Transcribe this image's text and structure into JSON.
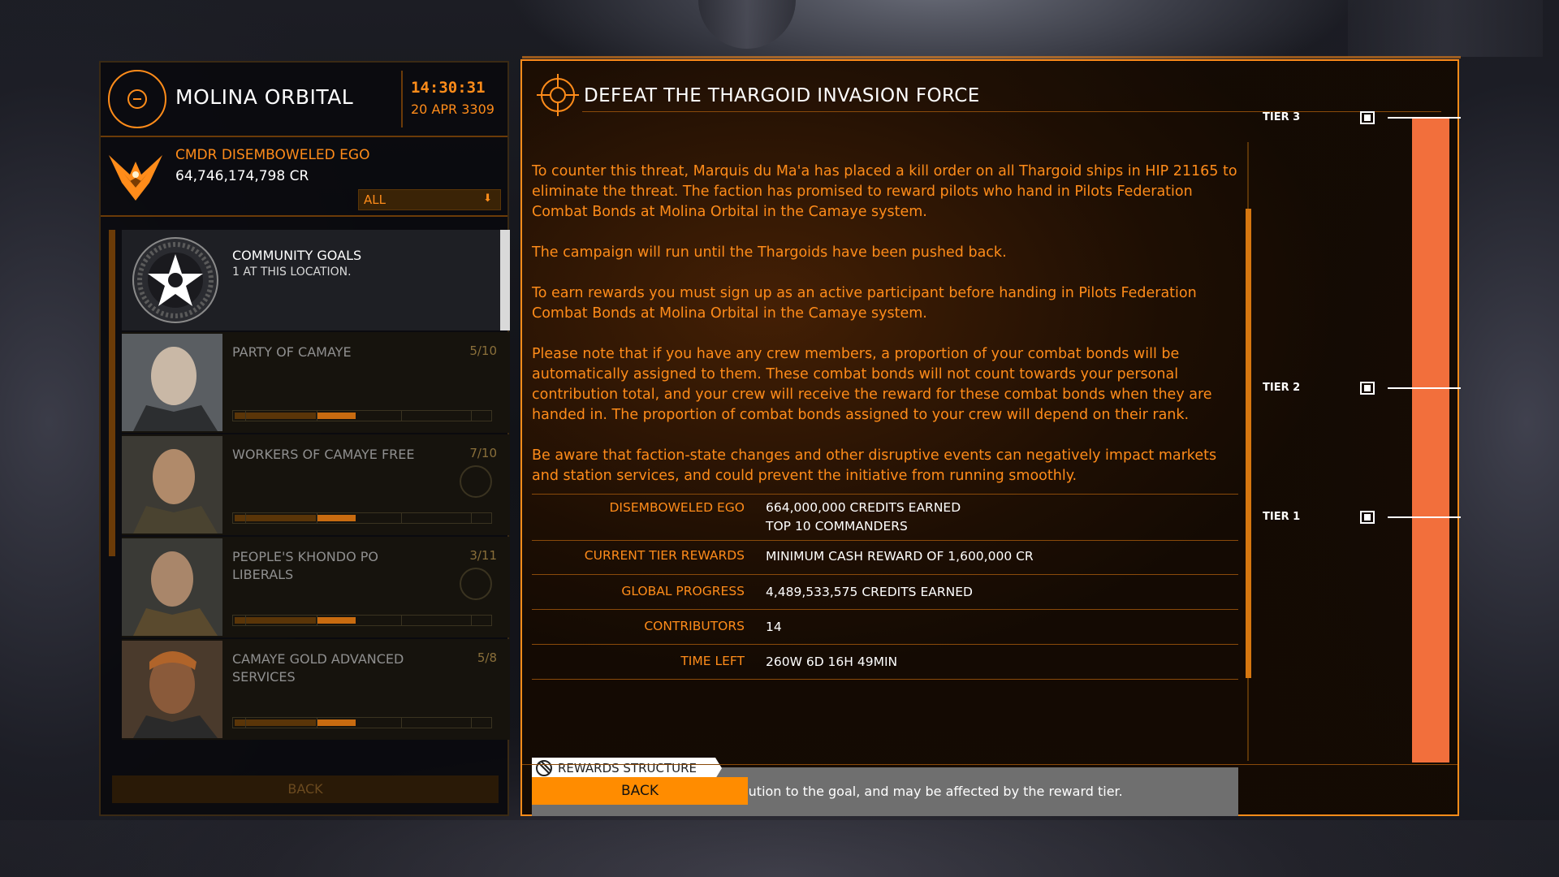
{
  "station": {
    "name": "MOLINA ORBITAL",
    "time": "14:30:31",
    "date": "20 APR 3309"
  },
  "commander": {
    "name": "CMDR DISEMBOWELED EGO",
    "credits": "64,746,174,798 CR",
    "filter": "ALL"
  },
  "community_goals_entry": {
    "title": "COMMUNITY GOALS",
    "subtitle": "1 AT THIS LOCATION."
  },
  "factions": [
    {
      "name": "PARTY OF CAMAYE",
      "count": "5/10",
      "reputation": 0.5
    },
    {
      "name": "WORKERS OF CAMAYE FREE",
      "count": "7/10",
      "reputation": 0.5
    },
    {
      "name": "PEOPLE'S KHONDO PO LIBERALS",
      "count": "3/11",
      "reputation": 0.5
    },
    {
      "name": "CAMAYE GOLD ADVANCED SERVICES",
      "count": "5/8",
      "reputation": 0.5
    }
  ],
  "left_back_label": "BACK",
  "goal": {
    "title": "DEFEAT THE THARGOID INVASION FORCE",
    "paragraphs": [
      "To counter this threat, Marquis du Ma'a has placed a kill order on all Thargoid ships in HIP 21165 to eliminate the threat. The faction has promised to reward pilots who hand in Pilots Federation Combat Bonds at Molina Orbital in the Camaye system.",
      "The campaign will run until the Thargoids have been pushed back.",
      "To earn rewards you must sign up as an active participant before handing in Pilots Federation Combat Bonds at Molina Orbital in the Camaye system.",
      "Please note that if you have any crew members, a proportion of your combat bonds will be automatically assigned to them. These combat bonds will not count towards your personal contribution total, and your crew will receive the reward for these combat bonds when they are handed in. The proportion of combat bonds assigned to your crew will depend on their rank.",
      "Be aware that faction-state changes and other disruptive events can negatively impact markets and station services, and could prevent the initiative from running smoothly."
    ],
    "stats": [
      {
        "label": "DISEMBOWELED EGO",
        "value": "664,000,000 CREDITS EARNED",
        "value2": "TOP 10 COMMANDERS"
      },
      {
        "label": "CURRENT TIER REWARDS",
        "value": "MINIMUM CASH REWARD OF 1,600,000 CR"
      },
      {
        "label": "GLOBAL PROGRESS",
        "value": "4,489,533,575 CREDITS EARNED"
      },
      {
        "label": "CONTRIBUTORS",
        "value": "14"
      },
      {
        "label": "TIME LEFT",
        "value": "260W 6D 16H 49MIN"
      }
    ],
    "rewards_tag": "REWARDS STRUCTURE",
    "rewards_text": "Rewards depend on your contribution to the goal, and may be affected by the reward tier.",
    "back_label": "BACK",
    "tiers": [
      {
        "label": "TIER 3",
        "level": 1.0
      },
      {
        "label": "TIER 2",
        "level": 0.58
      },
      {
        "label": "TIER 1",
        "level": 0.38
      }
    ],
    "progress": 1.0
  },
  "colors": {
    "accent": "#ff8c1a",
    "progress_fill": "#f26f3c",
    "button": "#ff8c00"
  }
}
